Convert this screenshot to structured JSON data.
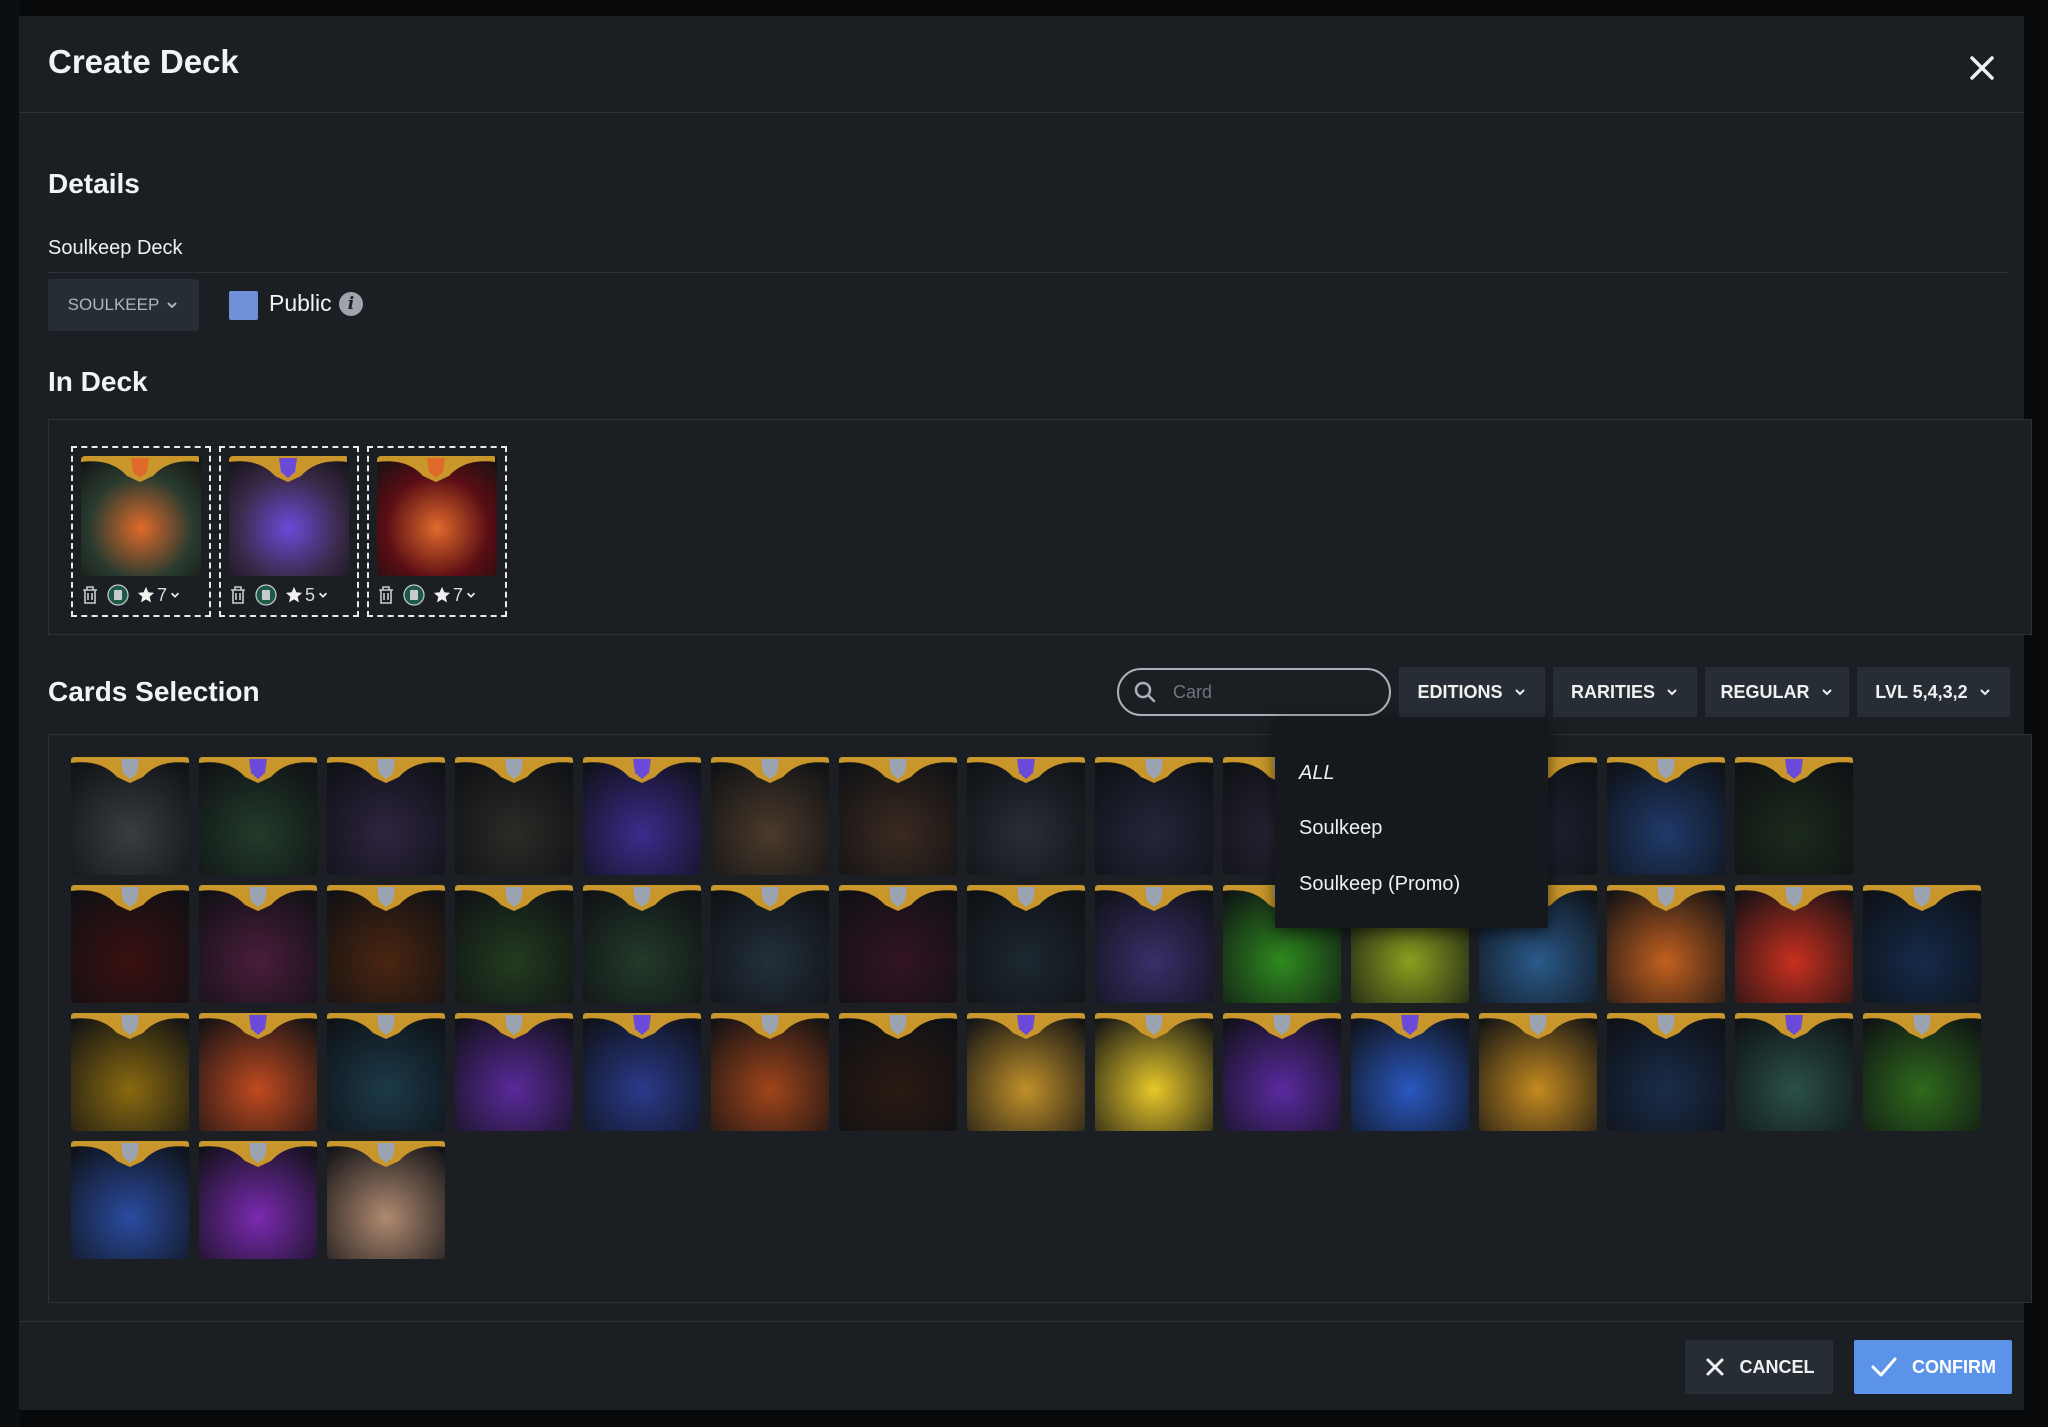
{
  "modal": {
    "title": "Create Deck"
  },
  "details": {
    "heading": "Details",
    "deck_name": "Soulkeep Deck",
    "edition_select": "SOULKEEP",
    "public_label": "Public",
    "info_icon": "info-icon"
  },
  "in_deck": {
    "heading": "In Deck",
    "cards": [
      {
        "level": "7",
        "art_color": "#2a3b2f",
        "accent": "#e06a2c",
        "name": "card-1"
      },
      {
        "level": "5",
        "art_color": "#3a2a4a",
        "accent": "#6a4bd8",
        "name": "card-2"
      },
      {
        "level": "7",
        "art_color": "#5a0d14",
        "accent": "#e06a2c",
        "name": "card-3"
      }
    ]
  },
  "selection": {
    "heading": "Cards Selection",
    "search_placeholder": "Card",
    "filters": {
      "editions": "EDITIONS",
      "rarities": "RARITIES",
      "regular": "REGULAR",
      "level": "LVL 5,4,3,2"
    },
    "editions_dropdown": [
      "ALL",
      "Soulkeep",
      "Soulkeep (Promo)"
    ]
  },
  "grid_colors": [
    [
      "#3a3d40",
      "#233b2a",
      "#2e2440",
      "#2b2a26",
      "#3d2b8c",
      "#4a3a2a",
      "#3a2a20",
      "#2a2d36",
      "#23263a",
      "#2a2436",
      "#2a2a33",
      "#1f2433",
      "#1f3a6a",
      "#1c2a1c"
    ],
    [
      "#3a1010",
      "#4a1d3a",
      "#4a2510",
      "#233b1f",
      "#243a2a",
      "#23303a",
      "#331424",
      "#1d2830",
      "#3a2f6a",
      "#2f8a1f",
      "#8aa01f",
      "#2a5a8a",
      "#c2601f",
      "#c8301f",
      "#152a4a"
    ],
    [
      "#8a6a10",
      "#c04a20",
      "#1c3a4a",
      "#5a2a9a",
      "#2a3a8a",
      "#a0451a",
      "#2a1a12",
      "#c0902a",
      "#e8c82a",
      "#5a2aa0",
      "#2a58c0",
      "#c48a1f",
      "#1a2c4a",
      "#2a5048",
      "#2e6a1c"
    ],
    [
      "#2a4ca0",
      "#7a2ab0",
      "#b08a70"
    ]
  ],
  "footer": {
    "cancel": "CANCEL",
    "confirm": "CONFIRM"
  }
}
